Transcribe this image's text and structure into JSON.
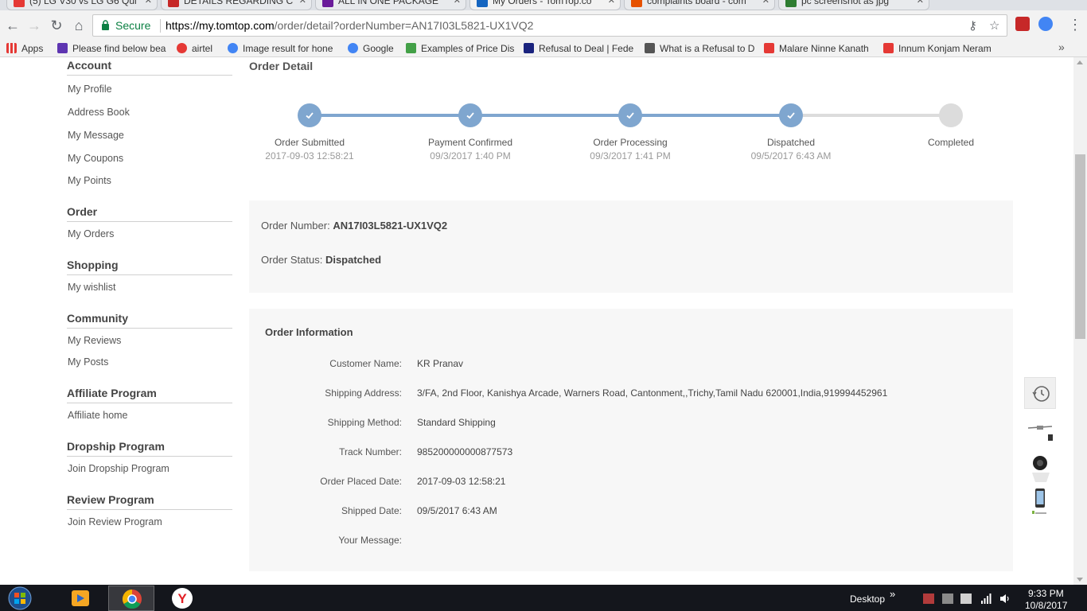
{
  "browser": {
    "tabs": [
      {
        "label": "(5) LG V30 vs LG G6 Qui",
        "fav_color": "#e53935"
      },
      {
        "label": "DETAILS REGARDING C",
        "fav_color": "#c62828"
      },
      {
        "label": "ALL IN ONE PACKAGE",
        "fav_color": "#6a1b9a"
      },
      {
        "label": "My Orders - TomTop.co",
        "fav_color": "#1565c0"
      },
      {
        "label": "complaints board - com",
        "fav_color": "#e65100"
      },
      {
        "label": "pc screenshot as jpg",
        "fav_color": "#2e7d32"
      }
    ],
    "secure_label": "Secure",
    "url_host": "https://my.tomtop.com",
    "url_path": "/order/detail?orderNumber=AN17I03L5821-UX1VQ2",
    "bookmarks": [
      {
        "label": "Apps",
        "color": "#e53935"
      },
      {
        "label": "Please find below bea",
        "color": "#5e35b1"
      },
      {
        "label": "airtel",
        "color": "#e53935"
      },
      {
        "label": "Image result for hone",
        "color": "#4285f4"
      },
      {
        "label": "Google",
        "color": "#4285f4"
      },
      {
        "label": "Examples of Price Dis",
        "color": "#43a047"
      },
      {
        "label": "Refusal to Deal | Fede",
        "color": "#1a237e"
      },
      {
        "label": "What is a Refusal to D",
        "color": "#555555"
      },
      {
        "label": "Malare Ninne Kanath",
        "color": "#e53935"
      },
      {
        "label": "Innum Konjam Neram",
        "color": "#e53935"
      }
    ]
  },
  "sidebar": {
    "sections": [
      {
        "heading": "Account",
        "items": [
          "My Profile",
          "Address Book",
          "My Message",
          "My Coupons",
          "My Points"
        ]
      },
      {
        "heading": "Order",
        "items": [
          "My Orders"
        ]
      },
      {
        "heading": "Shopping",
        "items": [
          "My wishlist"
        ]
      },
      {
        "heading": "Community",
        "items": [
          "My Reviews",
          "My Posts"
        ]
      },
      {
        "heading": "Affiliate Program",
        "items": [
          "Affiliate home"
        ]
      },
      {
        "heading": "Dropship Program",
        "items": [
          "Join Dropship Program"
        ]
      },
      {
        "heading": "Review Program",
        "items": [
          "Join Review Program"
        ]
      }
    ]
  },
  "order": {
    "title": "Order Detail",
    "steps": [
      {
        "label": "Order Submitted",
        "date": "2017-09-03 12:58:21",
        "done": true
      },
      {
        "label": "Payment Confirmed",
        "date": "09/3/2017 1:40 PM",
        "done": true
      },
      {
        "label": "Order Processing",
        "date": "09/3/2017 1:41 PM",
        "done": true
      },
      {
        "label": "Dispatched",
        "date": "09/5/2017 6:43 AM",
        "done": true
      },
      {
        "label": "Completed",
        "date": "",
        "done": false
      }
    ],
    "number_label": "Order Number:",
    "number_value": "AN17I03L5821-UX1VQ2",
    "status_label": "Order Status:",
    "status_value": "Dispatched",
    "info_title": "Order Information",
    "info": [
      {
        "label": "Customer Name:",
        "value": "KR Pranav"
      },
      {
        "label": "Shipping Address:",
        "value": "3/FA, 2nd Floor, Kanishya Arcade, Warners Road, Cantonment,,Trichy,Tamil Nadu 620001,India,919994452961"
      },
      {
        "label": "Shipping Method:",
        "value": "Standard Shipping"
      },
      {
        "label": "Track Number:",
        "value": "985200000000877573"
      },
      {
        "label": "Order Placed Date:",
        "value": "2017-09-03 12:58:21"
      },
      {
        "label": "Shipped Date:",
        "value": "09/5/2017 6:43 AM"
      },
      {
        "label": "Your Message:",
        "value": ""
      }
    ],
    "progress_color": "#7fa6cf",
    "pending_color": "#dcdcdc"
  },
  "taskbar": {
    "desktop_label": "Desktop",
    "time": "9:33 PM",
    "date": "10/8/2017"
  }
}
